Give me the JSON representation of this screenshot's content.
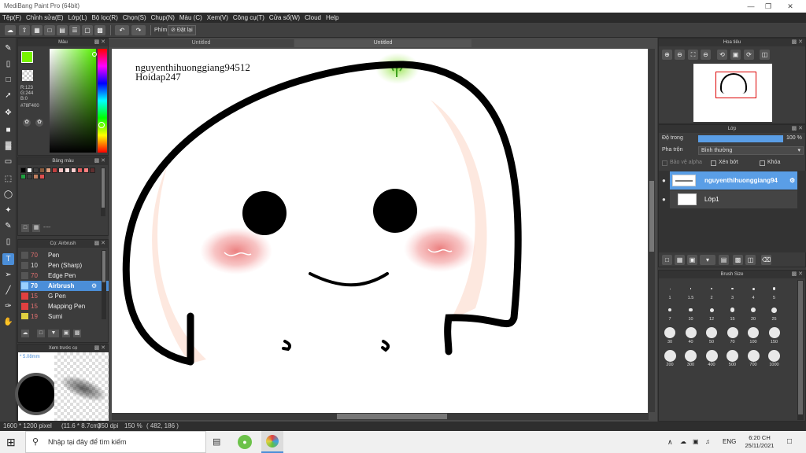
{
  "window": {
    "title": "MediBang Paint Pro (64bit)"
  },
  "menu": [
    "Tệp(F)",
    "Chỉnh sửa(E)",
    "Lớp(L)",
    "Bộ lọc(R)",
    "Chọn(S)",
    "Chụp(N)",
    "Màu (C)",
    "Xem(V)",
    "Công cụ(T)",
    "Cửa sổ(W)",
    "Cloud",
    "Help"
  ],
  "toolbar": {
    "phim_label": "Phím",
    "reset_label": "Đặt lại"
  },
  "color_panel": {
    "title": "Màu",
    "r": "R:123",
    "g": "G:244",
    "b": "B:0",
    "hex": "#78F400",
    "fg_color": "#78F400",
    "bg_color": "#000000"
  },
  "palette": {
    "title": "Bảng màu",
    "swatches": [
      "#000000",
      "#ffffff",
      "#404040",
      "#8a5a3c",
      "#e0a080",
      "#c04040",
      "#f0c0c0",
      "#ffe0e0",
      "#ffd0d0",
      "#e06060",
      "#ff8080",
      "#603030",
      "#20a040",
      "#404040",
      "#c08060",
      "#e05050"
    ],
    "footer": "----"
  },
  "brush_panel": {
    "title": "Cọ: Airbrush",
    "items": [
      {
        "size": "70",
        "name": "Pen",
        "color": "#202020"
      },
      {
        "size": "10",
        "name": "Pen (Sharp)",
        "color": "#202020"
      },
      {
        "size": "70",
        "name": "Edge Pen",
        "color": "#202020"
      },
      {
        "size": "70",
        "name": "Airbrush",
        "color": "#9ad0ff"
      },
      {
        "size": "15",
        "name": "G Pen",
        "color": "#e04040"
      },
      {
        "size": "15",
        "name": "Mapping Pen",
        "color": "#e04040"
      },
      {
        "size": "19",
        "name": "Sumi",
        "color": "#e0d040"
      }
    ]
  },
  "preview_panel": {
    "title": "Xem trước cọ",
    "size_label": "* 5.08mm"
  },
  "document": {
    "tab1": "Untitled",
    "tab2": "Untitled"
  },
  "canvas_text": {
    "line1": "nguyenthihuonggiang94512",
    "line2": "Hoidap247"
  },
  "navigator": {
    "title": "Hoa tiêu"
  },
  "layer_panel": {
    "title": "Lớp",
    "opacity_label": "Độ trong",
    "opacity_value": "100 %",
    "opacity": 1.0,
    "blend_label": "Pha trộn",
    "blend_value": "Bình thường",
    "protect_alpha": "Bảo vệ alpha",
    "clipping": "Xén bớt",
    "lock": "Khóa",
    "layers": [
      {
        "name": "nguyenthihuonggiang94",
        "selected": true
      },
      {
        "name": "Lớp1",
        "selected": false
      }
    ]
  },
  "brush_size_panel": {
    "title": "Brush Size",
    "sizes": [
      "1",
      "1.5",
      "2",
      "3",
      "4",
      "5",
      "7",
      "10",
      "12",
      "15",
      "20",
      "25",
      "30",
      "40",
      "50",
      "70",
      "100",
      "150",
      "200",
      "300",
      "400",
      "500",
      "700",
      "1000"
    ]
  },
  "status": {
    "dims": "1600 * 1200 pixel",
    "phys": "(11.6 * 8.7cm)",
    "dpi": "350 dpi",
    "zoom": "150 %",
    "coords": "( 482, 186 )"
  },
  "taskbar": {
    "search_placeholder": "Nhập tại đây để tìm kiếm",
    "lang": "ENG",
    "time": "6:20 CH",
    "date": "25/11/2021"
  }
}
